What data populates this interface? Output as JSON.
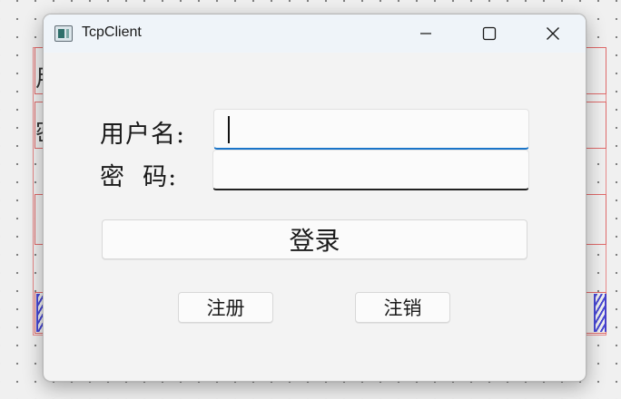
{
  "window": {
    "title": "TcpClient",
    "icon": "app-window-icon",
    "controls": [
      "minimize-icon",
      "maximize-icon",
      "close-icon"
    ]
  },
  "form": {
    "username_label": "用户名:",
    "password_label": "密  码:",
    "username_value": "",
    "password_value": "",
    "login_button": "登录",
    "register_button": "注册",
    "logout_button": "注销"
  },
  "designer": {
    "left_chars": [
      "用",
      "密"
    ],
    "blue_marks": [
      "///",
      "///"
    ]
  },
  "colors": {
    "focus_accent": "#1a75c9",
    "designer_outline": "#e06a6a",
    "designer_blue": "#2b2bd0"
  }
}
